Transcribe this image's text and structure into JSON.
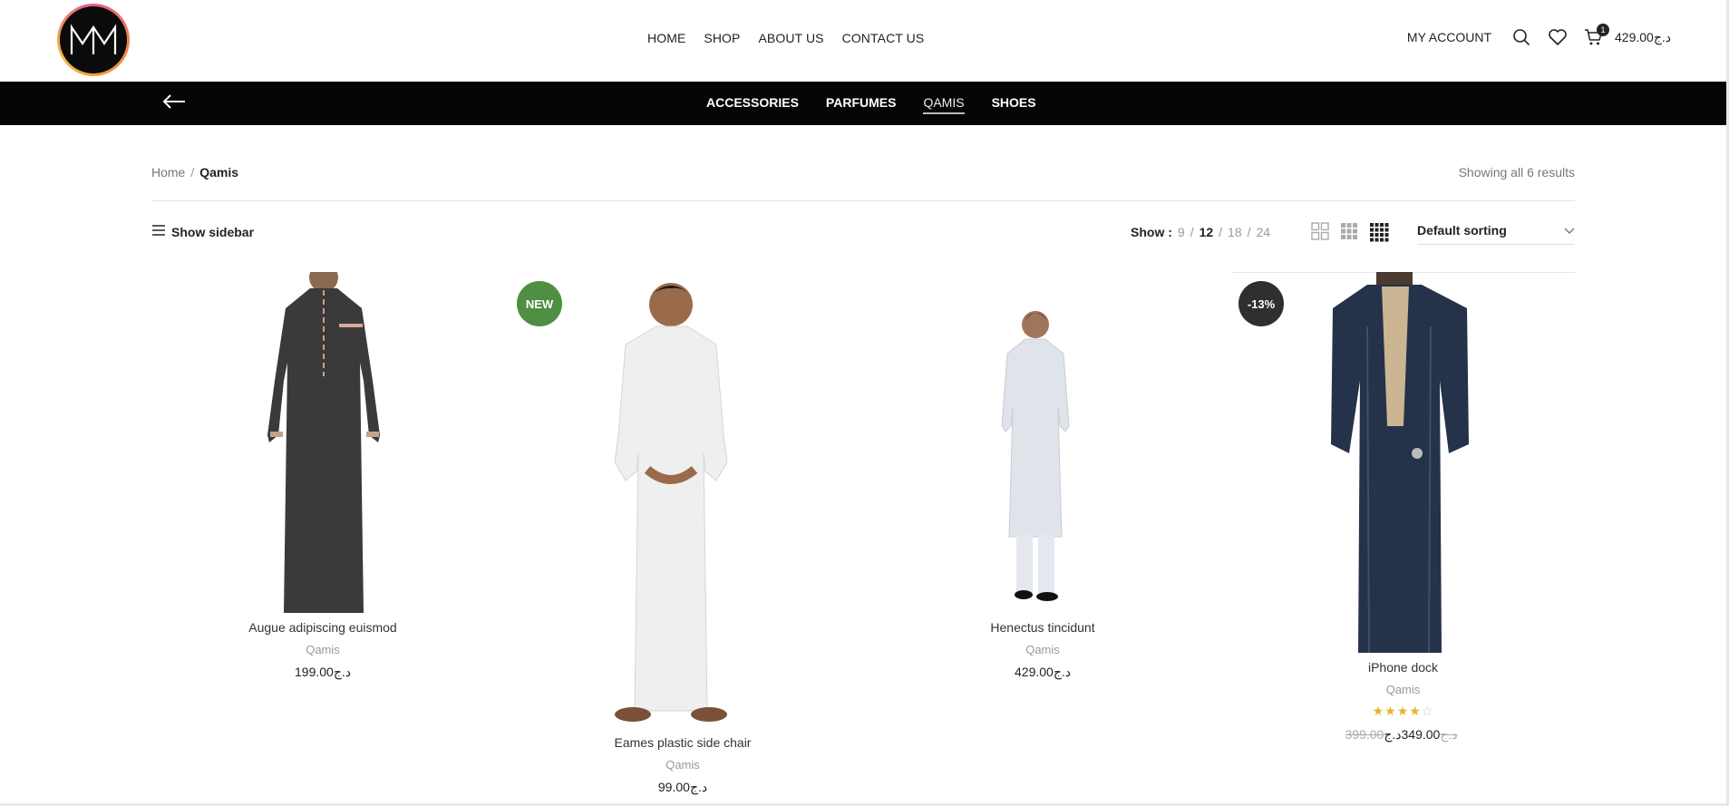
{
  "brand": {
    "logo_text": "MM"
  },
  "main_nav": [
    {
      "label": "HOME"
    },
    {
      "label": "SHOP"
    },
    {
      "label": "ABOUT US"
    },
    {
      "label": "CONTACT US"
    }
  ],
  "header_right": {
    "account_label": "MY ACCOUNT",
    "cart_count": "1",
    "cart_total": "429.00د.ج",
    "icons": [
      "search-icon",
      "heart-icon",
      "cart-icon"
    ]
  },
  "category_bar": {
    "back_icon": "arrow-left-icon",
    "items": [
      {
        "label": "ACCESSORIES",
        "active": false
      },
      {
        "label": "PARFUMES",
        "active": false
      },
      {
        "label": "QAMIS",
        "active": true
      },
      {
        "label": "SHOES",
        "active": false
      }
    ]
  },
  "breadcrumb": {
    "home": "Home",
    "separator": "/",
    "current": "Qamis"
  },
  "results_text": "Showing all 6 results",
  "toolbar": {
    "show_sidebar": "Show sidebar",
    "per_page_label": "Show :",
    "per_page_options": [
      "9",
      "12",
      "18",
      "24"
    ],
    "per_page_selected": "12",
    "sort_label": "Default sorting"
  },
  "products": [
    {
      "name": "Augue adipiscing euismod",
      "category": "Qamis",
      "price": "199.00د.ج",
      "badge": "",
      "robe_color": "#3a3a3a"
    },
    {
      "name": "Eames plastic side chair",
      "category": "Qamis",
      "price": "99.00د.ج",
      "badge": "NEW",
      "robe_color": "#efefef"
    },
    {
      "name": "Henectus tincidunt",
      "category": "Qamis",
      "price": "429.00د.ج",
      "badge": "",
      "robe_color": "#dfe3ea"
    },
    {
      "name": "iPhone dock",
      "category": "Qamis",
      "price": "349.00د.ج",
      "old_price": "399.00د.ج",
      "badge": "-13%",
      "rating": 4,
      "robe_color": "#24324a"
    }
  ]
}
